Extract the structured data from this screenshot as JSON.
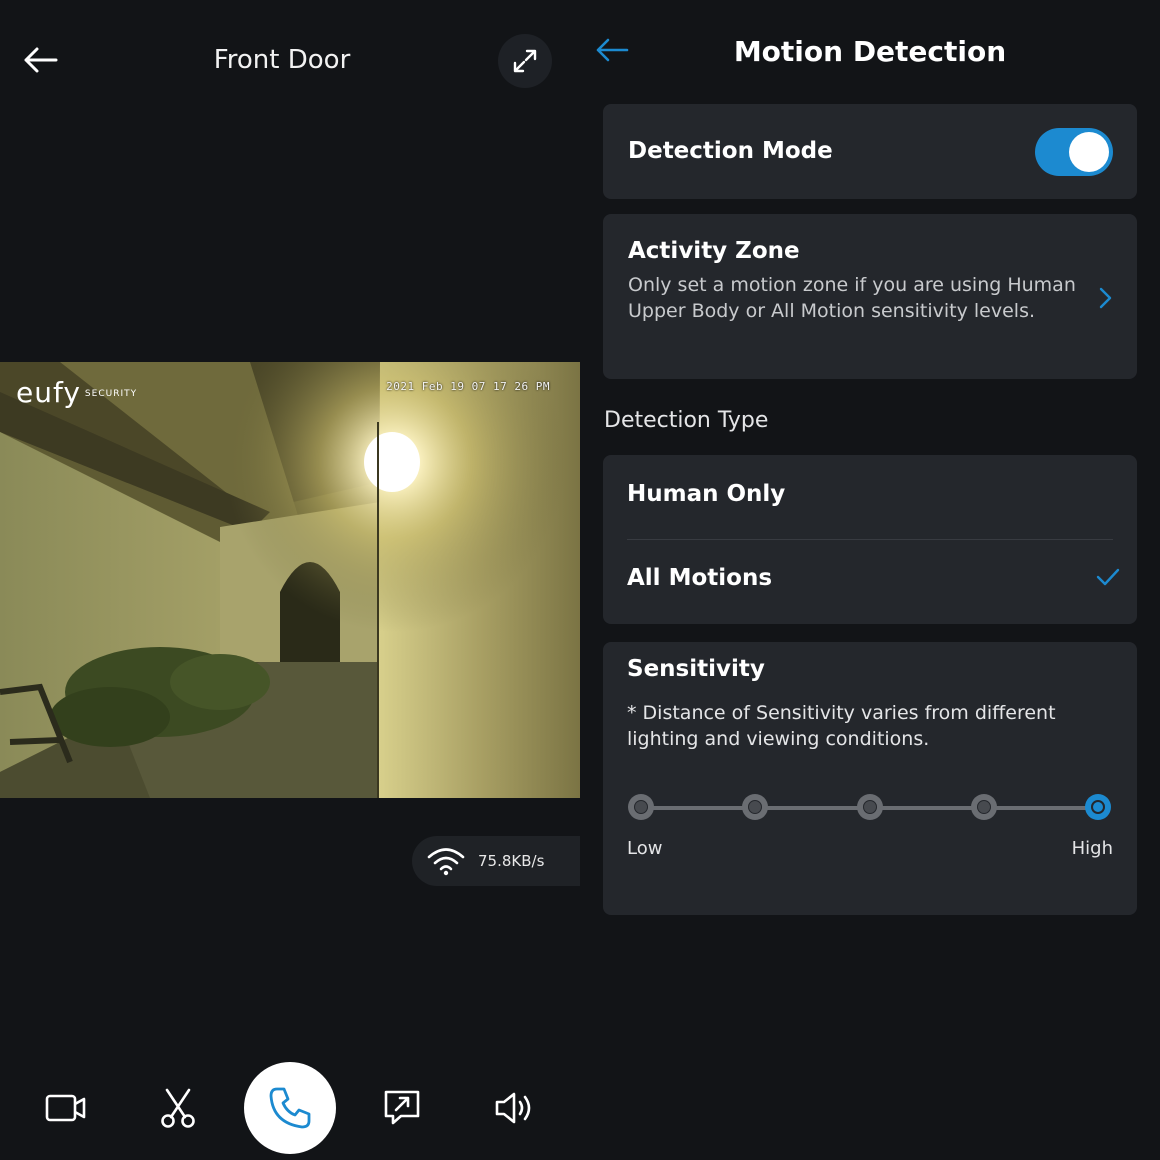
{
  "live_view": {
    "title": "Front Door",
    "camera_brand": "eufy",
    "camera_brand_sub": "SECURITY",
    "timestamp": "2021 Feb 19 07 17 26 PM",
    "data_rate": "75.8KB/s",
    "icons": {
      "back": "arrow-left-icon",
      "expand": "expand-icon",
      "wifi": "wifi-icon",
      "record": "video-camera-icon",
      "clip": "scissors-icon",
      "call": "phone-icon",
      "share": "share-icon",
      "speaker": "speaker-icon"
    }
  },
  "motion_detection": {
    "title": "Motion Detection",
    "accent_color": "#1c8ad0",
    "detection_mode": {
      "label": "Detection Mode",
      "enabled": true
    },
    "activity_zone": {
      "title": "Activity Zone",
      "description": "Only set a motion zone if you are using Human Upper Body or All Motion sensitivity levels."
    },
    "detection_type": {
      "section_label": "Detection Type",
      "options": [
        {
          "label": "Human Only",
          "selected": false
        },
        {
          "label": "All Motions",
          "selected": true
        }
      ]
    },
    "sensitivity": {
      "title": "Sensitivity",
      "note": "* Distance of Sensitivity varies from different lighting and viewing conditions.",
      "levels": 5,
      "selected_level": 5,
      "low_label": "Low",
      "high_label": "High"
    }
  }
}
